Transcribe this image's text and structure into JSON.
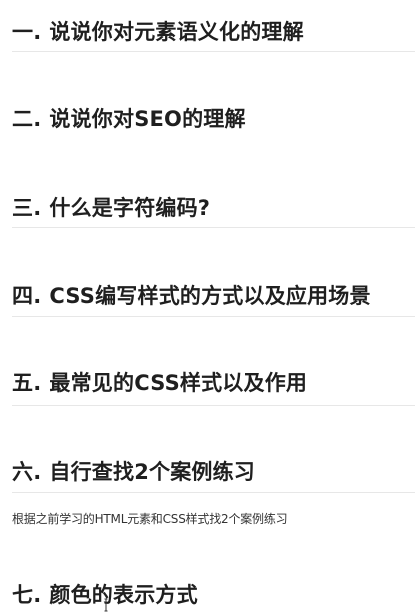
{
  "headings": [
    {
      "num": "一.",
      "text": "说说你对元素语义化的理解"
    },
    {
      "num": "二.",
      "text": "说说你对SEO的理解"
    },
    {
      "num": "三.",
      "text": "什么是字符编码?"
    },
    {
      "num": "四.",
      "text": "CSS编写样式的方式以及应用场景"
    },
    {
      "num": "五.",
      "text": "最常见的CSS样式以及作用"
    },
    {
      "num": "六.",
      "text": "自行查找2个案例练习"
    },
    {
      "num": "七.",
      "text": "颜色的表示方式"
    }
  ],
  "paragraph": "根据之前学习的HTML元素和CSS样式找2个案例练习",
  "icons": {
    "cursor": "text-cursor-icon"
  },
  "colors": {
    "heading": "#1f1f1f",
    "rule": "#e7e7e7",
    "background": "#ffffff"
  }
}
